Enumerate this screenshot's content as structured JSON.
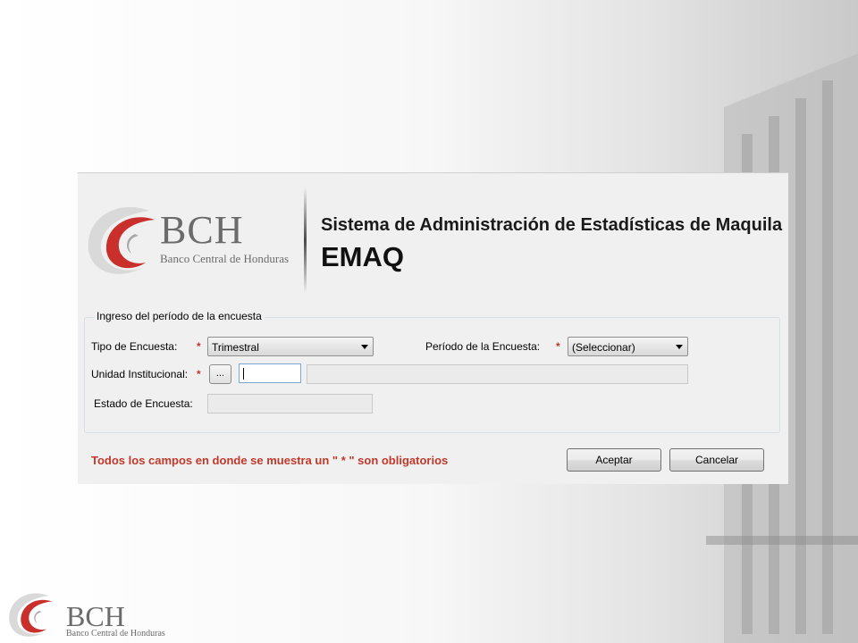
{
  "window": {
    "title": "Sistema de Administración de Estadísticas de Maquila",
    "code": "EMAQ"
  },
  "logo": {
    "letters": "BCH",
    "subtitle": "Banco Central de Honduras"
  },
  "form": {
    "group_title": "Ingreso del período de la encuesta",
    "required_mark": "*",
    "tipo_encuesta": {
      "label": "Tipo de Encuesta:",
      "value": "Trimestral"
    },
    "periodo_encuesta": {
      "label": "Período de la Encuesta:",
      "value": "(Seleccionar)"
    },
    "unidad_institucional": {
      "label": "Unidad Institucional:",
      "browse_label": "...",
      "code_value": "",
      "name_value": ""
    },
    "estado_encuesta": {
      "label": "Estado de Encuesta:",
      "value": ""
    }
  },
  "footer": {
    "required_note": "Todos los campos en donde se muestra un \" * \" son obligatorios",
    "accept_label": "Aceptar",
    "cancel_label": "Cancelar"
  },
  "icons": {
    "combo_arrow": "chevron-down-icon",
    "logo_swirl": "swirl-logo-icon"
  },
  "colors": {
    "required": "#c0392b",
    "logo_red": "#c9302c",
    "logo_gray": "#6b6b6b"
  }
}
